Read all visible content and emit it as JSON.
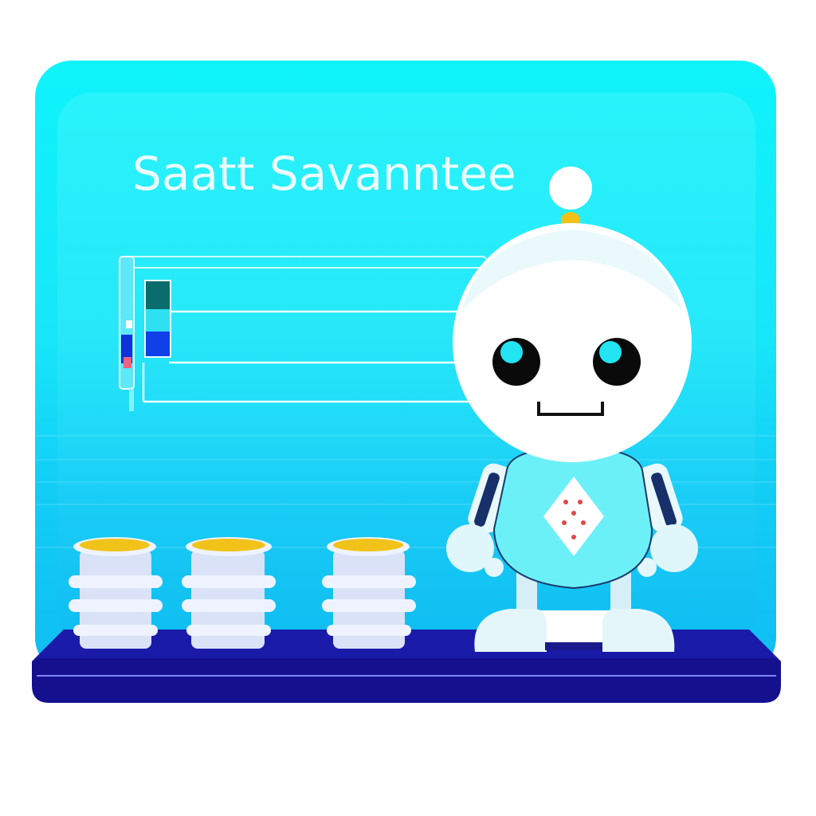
{
  "scene": {
    "title": "Saatt Savanntee"
  },
  "colors": {
    "panel": "#14e3f8",
    "shelf": "#1210a0",
    "robot_body": "#6cf0f8",
    "robot_head": "#ffffff",
    "coin_top": "#f1c21a",
    "coin_side": "#d9e6ff",
    "heart_dots": "#e04848"
  },
  "icons": {
    "robot": "robot-mascot",
    "coins": "coin-stack",
    "diamond": "diamond-card-icon"
  }
}
